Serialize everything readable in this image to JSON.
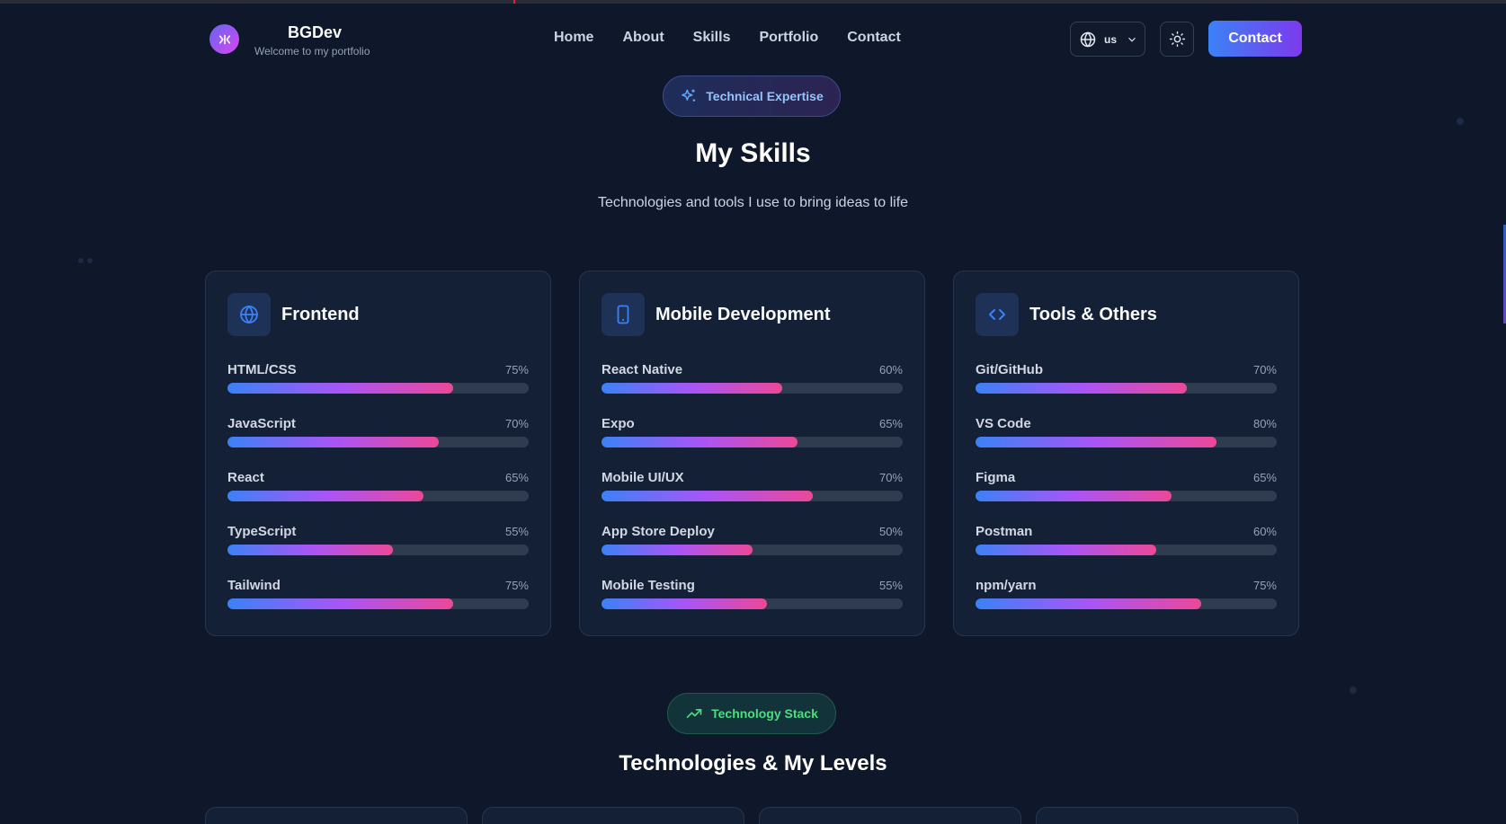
{
  "brand": {
    "name": "BGDev",
    "tagline": "Welcome to my portfolio"
  },
  "nav": {
    "links": [
      "Home",
      "About",
      "Skills",
      "Portfolio",
      "Contact"
    ]
  },
  "header_actions": {
    "language": "us",
    "contact_label": "Contact"
  },
  "skills_section": {
    "badge": "Technical Expertise",
    "title": "My Skills",
    "subtitle": "Technologies and tools I use to bring ideas to life"
  },
  "cards": [
    {
      "title": "Frontend",
      "icon": "globe-icon",
      "skills": [
        {
          "name": "HTML/CSS",
          "percent": "75%",
          "level": 75
        },
        {
          "name": "JavaScript",
          "percent": "70%",
          "level": 70
        },
        {
          "name": "React",
          "percent": "65%",
          "level": 65
        },
        {
          "name": "TypeScript",
          "percent": "55%",
          "level": 55
        },
        {
          "name": "Tailwind",
          "percent": "75%",
          "level": 75
        }
      ]
    },
    {
      "title": "Mobile Development",
      "icon": "smartphone-icon",
      "skills": [
        {
          "name": "React Native",
          "percent": "60%",
          "level": 60
        },
        {
          "name": "Expo",
          "percent": "65%",
          "level": 65
        },
        {
          "name": "Mobile UI/UX",
          "percent": "70%",
          "level": 70
        },
        {
          "name": "App Store Deploy",
          "percent": "50%",
          "level": 50
        },
        {
          "name": "Mobile Testing",
          "percent": "55%",
          "level": 55
        }
      ]
    },
    {
      "title": "Tools & Others",
      "icon": "code-icon",
      "skills": [
        {
          "name": "Git/GitHub",
          "percent": "70%",
          "level": 70
        },
        {
          "name": "VS Code",
          "percent": "80%",
          "level": 80
        },
        {
          "name": "Figma",
          "percent": "65%",
          "level": 65
        },
        {
          "name": "Postman",
          "percent": "60%",
          "level": 60
        },
        {
          "name": "npm/yarn",
          "percent": "75%",
          "level": 75
        }
      ]
    }
  ],
  "stack_section": {
    "badge": "Technology Stack",
    "title": "Technologies & My Levels"
  },
  "colors": {
    "background": "#0f172a",
    "card": "#142036",
    "accent_blue": "#3b82f6",
    "accent_purple": "#a855f7",
    "accent_pink": "#ec4899",
    "accent_green": "#4ade80"
  }
}
